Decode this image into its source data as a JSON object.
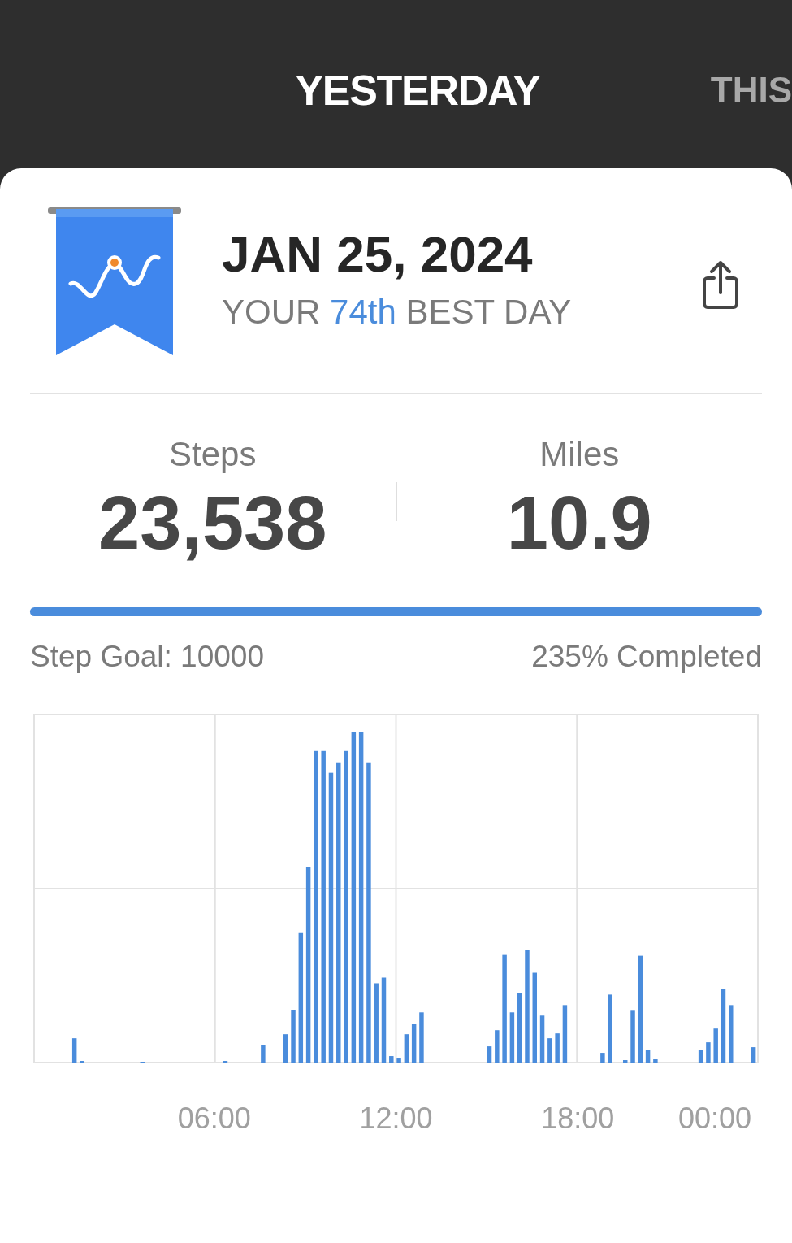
{
  "tabs": [
    {
      "label": "YESTERDAY",
      "selected": true
    },
    {
      "label": "THIS",
      "selected": false
    }
  ],
  "day": {
    "date": "JAN 25, 2024",
    "rank_prefix": "YOUR",
    "rank": "74th",
    "rank_suffix": "BEST DAY"
  },
  "stats": [
    {
      "label": "Steps",
      "value": "23,538"
    },
    {
      "label": "Miles",
      "value": "10.9"
    }
  ],
  "goal": {
    "level": 1,
    "label": "Step Goal: 10000",
    "completed": "235% Completed"
  },
  "chart": {
    "x_labels": [
      "06:00",
      "12:00",
      "18:00",
      "00:00"
    ]
  }
}
